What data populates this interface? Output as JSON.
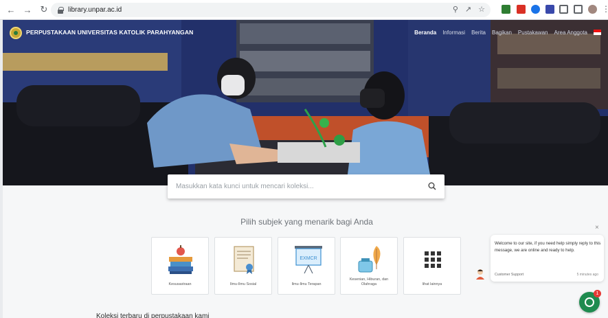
{
  "browser": {
    "url": "library.unpar.ac.id"
  },
  "site": {
    "title": "PERPUSTAKAAN UNIVERSITAS KATOLIK PARAHYANGAN",
    "menu": [
      "Beranda",
      "Informasi",
      "Berita",
      "Bagikan",
      "Pustakawan",
      "Area Anggota"
    ]
  },
  "search": {
    "placeholder": "Masukkan kata kunci untuk mencari koleksi..."
  },
  "subjects": {
    "heading": "Pilih subjek yang menarik bagi Anda",
    "cards": [
      {
        "label": "Kesusastraan",
        "icon": "books-apple-icon"
      },
      {
        "label": "Ilmu-Ilmu Sosial",
        "icon": "scroll-certificate-icon"
      },
      {
        "label": "Ilmu-Ilmu Terapan",
        "icon": "projector-screen-icon"
      },
      {
        "label": "Kesenian, Hiburan, dan Olahraga",
        "icon": "ink-quill-icon"
      },
      {
        "label": "lihat lainnya",
        "icon": "grid-dots-icon"
      }
    ],
    "projector_text": "EXMCR"
  },
  "bottom": {
    "text": "Koleksi terbaru di perpustakaan kami"
  },
  "chat": {
    "message": "Welcome to our site, if you need help simply reply to this message, we are online and ready to help.",
    "agent": "Customer Support",
    "time": "5 minutes ago",
    "badge": "1",
    "close": "×"
  },
  "colors": {
    "hero_bg": "#1d2e66",
    "chat_green": "#1e8b4f",
    "badge_red": "#e53935"
  }
}
